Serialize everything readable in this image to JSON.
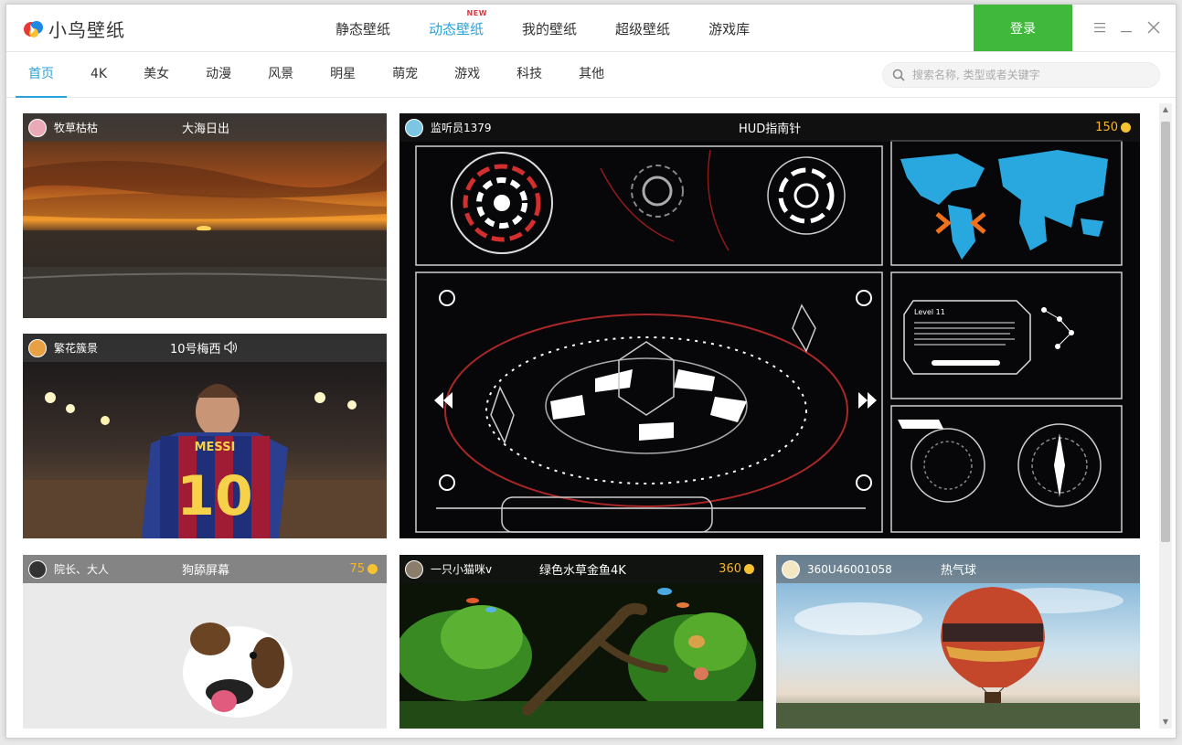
{
  "app": {
    "logo_text": "小鸟壁纸",
    "login_label": "登录"
  },
  "mainnav": [
    {
      "label": "静态壁纸"
    },
    {
      "label": "动态壁纸",
      "badge": "NEW"
    },
    {
      "label": "我的壁纸"
    },
    {
      "label": "超级壁纸"
    },
    {
      "label": "游戏库"
    }
  ],
  "categories": [
    "首页",
    "4K",
    "美女",
    "动漫",
    "风景",
    "明星",
    "萌宠",
    "游戏",
    "科技",
    "其他"
  ],
  "search": {
    "placeholder": "搜索名称, 类型或者关键字"
  },
  "cards": [
    {
      "user": "牧草枯枯",
      "title": "大海日出"
    },
    {
      "user": "繁花簇景",
      "title": "10号梅西"
    },
    {
      "user": "监听员1379",
      "title": "HUD指南针",
      "coins": "150"
    },
    {
      "user": "院长、大人",
      "title": "狗舔屏幕",
      "coins": "75"
    },
    {
      "user": "一只小猫咪v",
      "title": "绿色水草金鱼4K",
      "coins": "360"
    },
    {
      "user": "360U46001058",
      "title": "热气球"
    }
  ],
  "hud_text": {
    "level": "Level 11"
  },
  "jersey": {
    "name": "MESSI",
    "number": "10"
  },
  "colors": {
    "accent": "#2ba3d8",
    "login": "#3fb83c",
    "coin": "#f5b62b"
  }
}
